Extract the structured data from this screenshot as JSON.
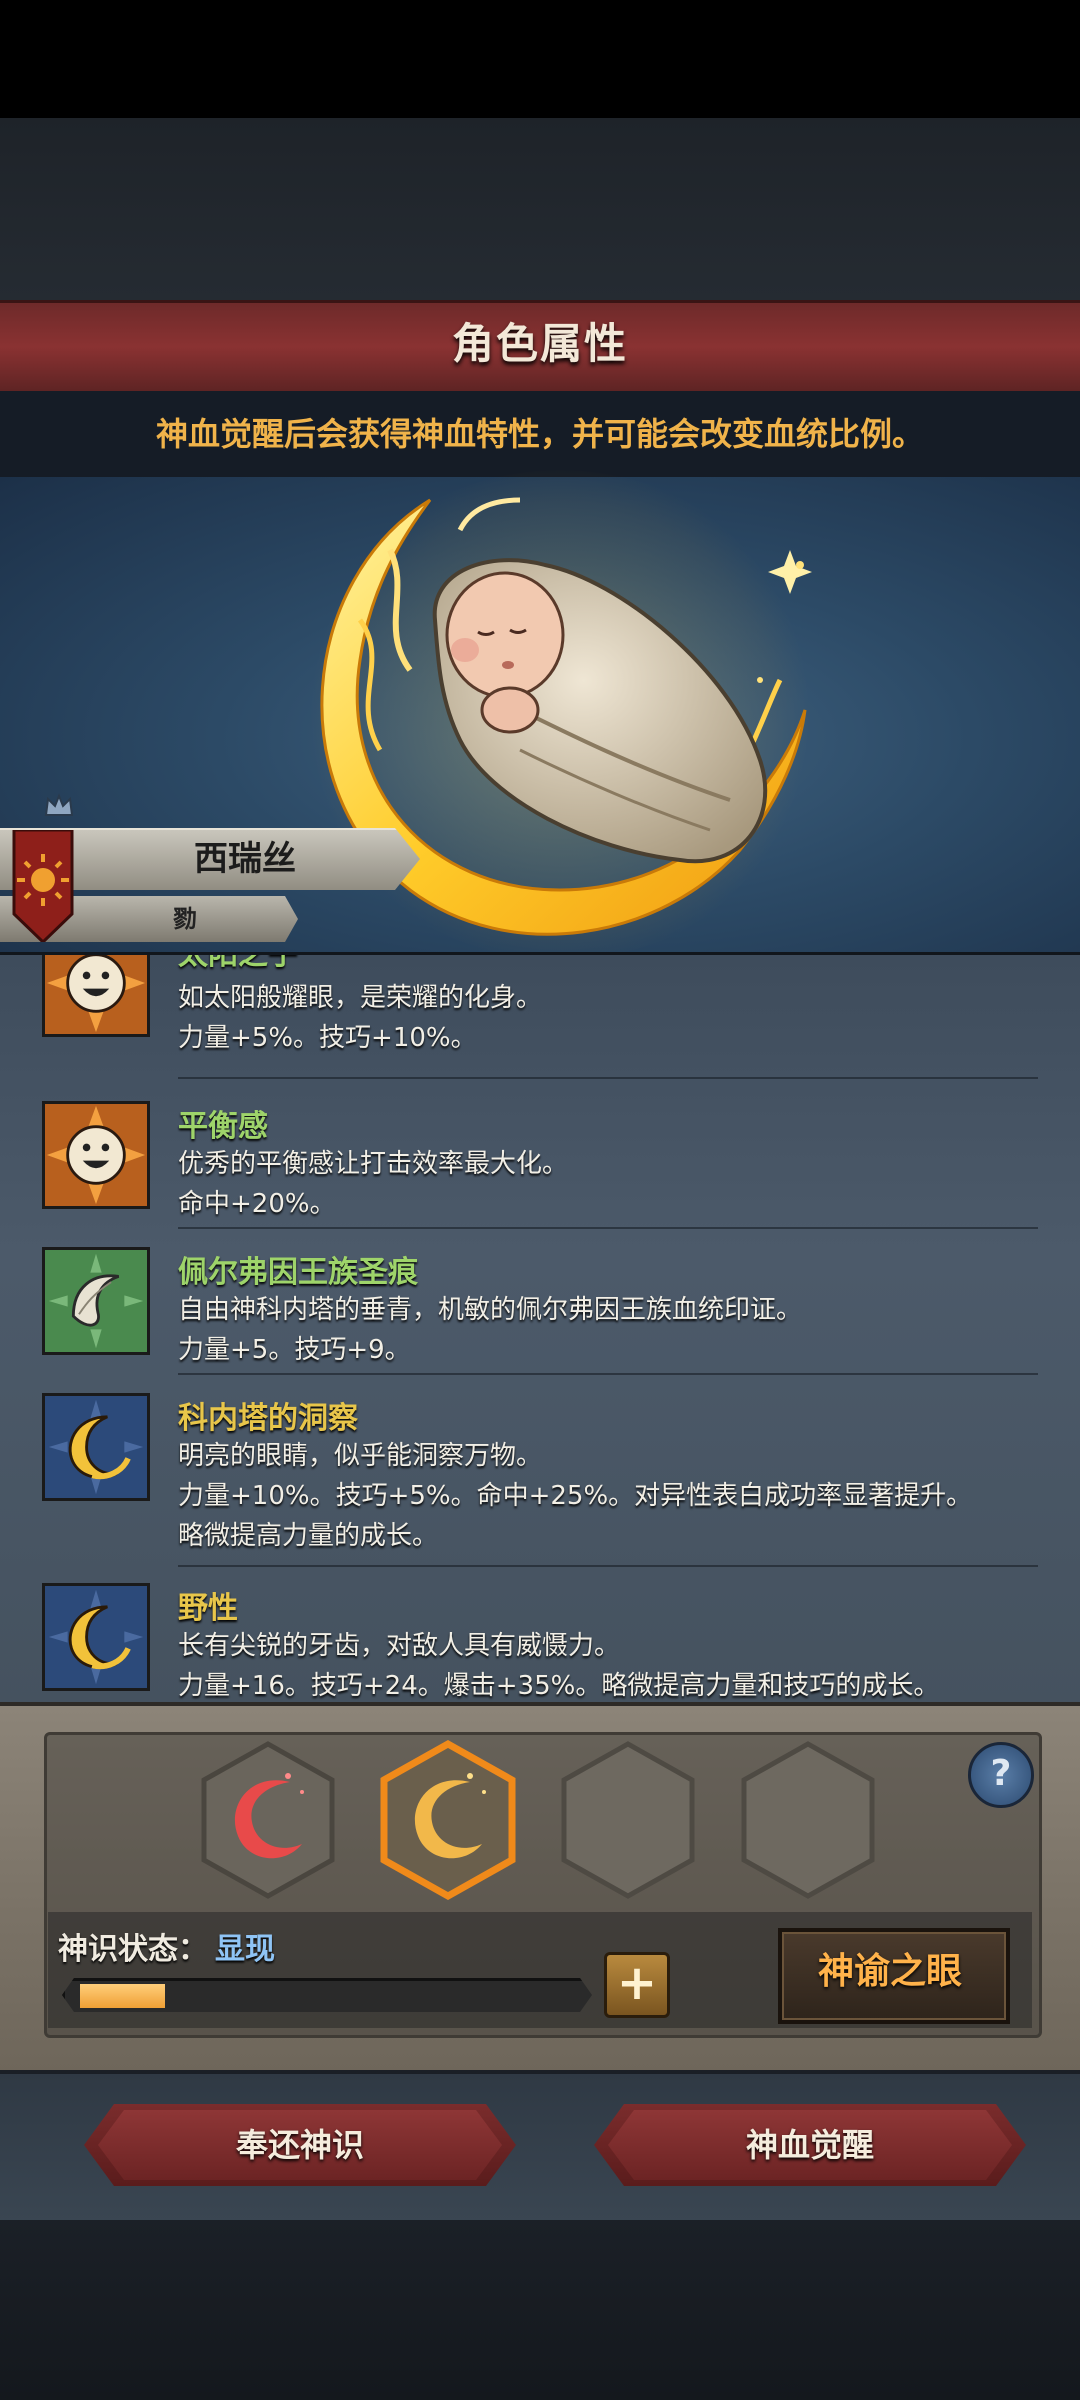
{
  "header": {
    "title": "角色属性",
    "subtitle": "神血觉醒后会获得神血特性，并可能会改变血统比例。"
  },
  "character": {
    "name": "西瑞丝",
    "rank": "勠"
  },
  "traits": [
    {
      "name": "太阳之子",
      "name_color": "#9ed46a",
      "icon": "smiling-sun-icon",
      "lines": [
        "如太阳般耀眼，是荣耀的化身。",
        "力量+5%。技巧+10%。"
      ]
    },
    {
      "name": "平衡感",
      "name_color": "#9ed46a",
      "icon": "smiling-sun-icon",
      "lines": [
        "优秀的平衡感让打击效率最大化。",
        "命中+20%。"
      ]
    },
    {
      "name": "佩尔弗因王族圣痕",
      "name_color": "#9ed46a",
      "icon": "white-feather-icon",
      "lines": [
        "自由神科内塔的垂青，机敏的佩尔弗因王族血统印证。",
        "力量+5。技巧+9。"
      ]
    },
    {
      "name": "科内塔的洞察",
      "name_color": "#e8c64a",
      "icon": "golden-crescent-icon",
      "lines": [
        "明亮的眼睛，似乎能洞察万物。",
        "力量+10%。技巧+5%。命中+25%。对异性表白成功率显著提升。",
        "略微提高力量的成长。"
      ]
    },
    {
      "name": "野性",
      "name_color": "#e8c64a",
      "icon": "golden-crescent-icon",
      "lines": [
        "长有尖锐的牙齿，对敌人具有威慑力。",
        "力量+16。技巧+24。爆击+35%。略微提高力量和技巧的成长。"
      ]
    }
  ],
  "divine_sense": {
    "status_label": "神识状态：",
    "status_value": "显现",
    "progress_fraction": 0.17,
    "slots": [
      {
        "icon": "red-crescent-icon",
        "state": "filled",
        "color": "#e84a4a"
      },
      {
        "icon": "gold-crescent-icon",
        "state": "selected",
        "color": "#f2b84a"
      },
      {
        "icon": "empty-slot-icon",
        "state": "empty"
      },
      {
        "icon": "empty-slot-icon",
        "state": "empty"
      }
    ],
    "help_symbol": "?",
    "plus_symbol": "+",
    "oracle_button": "神谕之眼"
  },
  "actions": {
    "return_button": "奉还神识",
    "awaken_button": "神血觉醒"
  }
}
